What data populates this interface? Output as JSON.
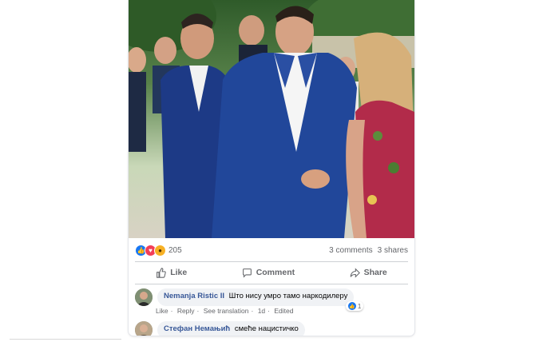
{
  "post": {
    "reactions": {
      "count": "205",
      "types": [
        "like-icon",
        "love-icon",
        "wow-icon"
      ],
      "colors": {
        "like": "#1877f2",
        "love": "#f33e58",
        "wow": "#f7b125"
      }
    },
    "comments_count": "3 comments",
    "shares_count": "3 shares"
  },
  "actions": {
    "like_label": "Like",
    "comment_label": "Comment",
    "share_label": "Share"
  },
  "comments": [
    {
      "author": "Nemanja Ristic II",
      "text": "Што нису умро тамо наркодилеру",
      "like_action": "Like",
      "reply_action": "Reply",
      "translate_action": "See translation",
      "time": "1d",
      "edited": "Edited",
      "reaction_count": "1"
    },
    {
      "author": "Стефан Немањић",
      "text": "смеће нацистичко"
    }
  ],
  "theme": {
    "link_color": "#385898",
    "muted": "#65676b",
    "bubble": "#f0f2f5"
  }
}
